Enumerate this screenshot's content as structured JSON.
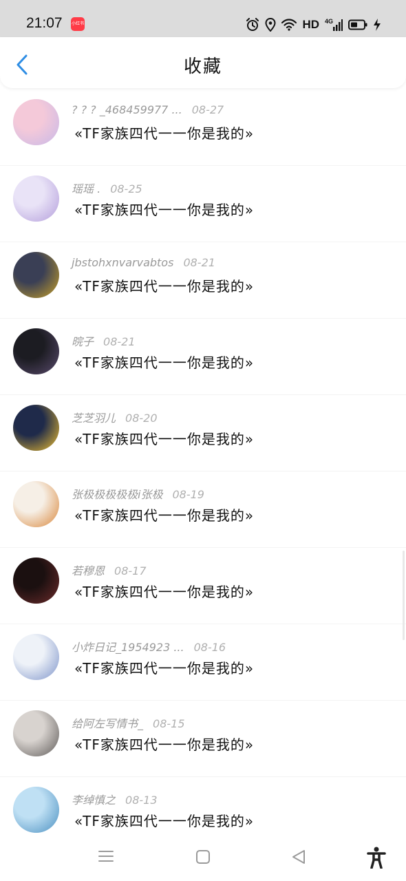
{
  "status_bar": {
    "time": "21:07",
    "app_badge_text": "小红书",
    "network_label": "HD",
    "network_type": "4G",
    "icons": [
      "alarm-icon",
      "location-icon",
      "wifi-icon",
      "signal-icon",
      "battery-icon",
      "charging-icon"
    ]
  },
  "header": {
    "title": "收藏",
    "back_icon": "chevron-left-icon",
    "accent_color": "#2e8de4"
  },
  "items": [
    {
      "user": "? ? ? _468459977 ...",
      "date": "08-27",
      "title": "«TF家族四代一一你是我的»",
      "avatar_colors": [
        "#f4c9d9",
        "#c7b8e8"
      ]
    },
    {
      "user": "瑶瑶 .",
      "date": "08-25",
      "title": "«TF家族四代一一你是我的»",
      "avatar_colors": [
        "#e9e3f7",
        "#b39ddb"
      ]
    },
    {
      "user": "jbstohxnvarvabtos",
      "date": "08-21",
      "title": "«TF家族四代一一你是我的»",
      "avatar_colors": [
        "#3a3f55",
        "#c9a227"
      ]
    },
    {
      "user": "晥子",
      "date": "08-21",
      "title": "«TF家族四代一一你是我的»",
      "avatar_colors": [
        "#1c1c22",
        "#5a4b6e"
      ]
    },
    {
      "user": "芝芝羽儿",
      "date": "08-20",
      "title": "«TF家族四代一一你是我的»",
      "avatar_colors": [
        "#1f2a4a",
        "#f2c230"
      ]
    },
    {
      "user": "张极极极极极i张极",
      "date": "08-19",
      "title": "«TF家族四代一一你是我的»",
      "avatar_colors": [
        "#f6efe6",
        "#d9863a"
      ]
    },
    {
      "user": "若穆恩",
      "date": "08-17",
      "title": "«TF家族四代一一你是我的»",
      "avatar_colors": [
        "#1b1010",
        "#6e2b2b"
      ]
    },
    {
      "user": "小炸日记_1954923 ...",
      "date": "08-16",
      "title": "«TF家族四代一一你是我的»",
      "avatar_colors": [
        "#eef2f8",
        "#7d93c9"
      ]
    },
    {
      "user": "给阿左写情书_",
      "date": "08-15",
      "title": "«TF家族四代一一你是我的»",
      "avatar_colors": [
        "#d8d3cf",
        "#5e5a58"
      ]
    },
    {
      "user": "李绰慎之",
      "date": "08-13",
      "title": "«TF家族四代一一你是我的»",
      "avatar_colors": [
        "#bfe0f4",
        "#4a8fc0"
      ]
    }
  ],
  "nav_bar": {
    "icons": [
      "menu-icon",
      "home-square-icon",
      "back-triangle-icon",
      "accessibility-icon"
    ]
  }
}
